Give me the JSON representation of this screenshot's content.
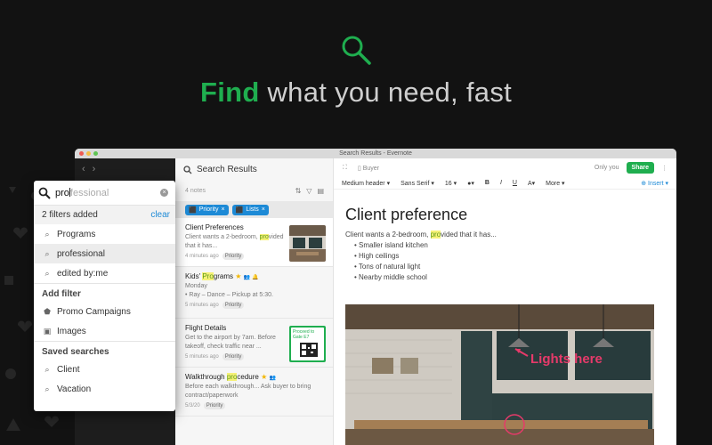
{
  "hero": {
    "headline_accent": "Find",
    "headline_rest": " what you need, fast",
    "accent_color": "#1fae4f",
    "icon": "search-icon"
  },
  "window": {
    "title": "Search Results - Evernote"
  },
  "notelist": {
    "header": "Search Results",
    "count": "4 notes",
    "chips": [
      "Priority",
      "Lists"
    ],
    "notes": [
      {
        "title": "Client Preferences",
        "body_pre": "Client wants a 2-bedroom, ",
        "body_hl": "pro",
        "body_post": "vided that it has...",
        "time": "4 minutes ago",
        "tag": "Priority"
      },
      {
        "title_pre": "Kids' ",
        "title_hl": "Pro",
        "title_post": "grams",
        "body_line1": "Monday",
        "body_line2": "• Ray – Dance – Pickup at 5:30.",
        "time": "5 minutes ago",
        "tag": "Priority"
      },
      {
        "title": "Flight Details",
        "body": "Get to the airport by 7am. Before takeoff, check traffic near ...",
        "time": "5 minutes ago",
        "tag": "Priority",
        "ticket_line1": "Proceed to",
        "ticket_line2": "Gate E7"
      },
      {
        "title_pre": "Walkthrough ",
        "title_hl": "pro",
        "title_post": "cedure",
        "body": "Before each walkthrough... Ask buyer to bring contract/paperwork",
        "time": "5/3/20",
        "tag": "Priority"
      }
    ]
  },
  "editor": {
    "notebook": "Buyer",
    "visibility": "Only you",
    "share": "Share",
    "format": {
      "style": "Medium header",
      "font": "Sans Serif",
      "size": "16",
      "bold": "B",
      "italic": "I",
      "underline": "U",
      "highlight": "A",
      "more": "More",
      "insert": "Insert"
    },
    "doc_title": "Client preference",
    "doc_intro_pre": "Client wants a 2-bedroom, ",
    "doc_intro_hl": "pro",
    "doc_intro_post": "vided that it has...",
    "bullets": [
      "Smaller island kitchen",
      "High ceilings",
      "Tons of natural light",
      "Nearby middle school"
    ],
    "image_annotation": "Lights here"
  },
  "search": {
    "typed": "pro",
    "suggestion_rest": "fessional",
    "filters_text": "2 filters added",
    "clear_label": "clear",
    "suggestions": [
      "Programs",
      "professional",
      "edited by:me"
    ],
    "add_filter_title": "Add filter",
    "add_filters": [
      {
        "label": "Promo Campaigns",
        "icon": "tag-icon"
      },
      {
        "label": "Images",
        "icon": "image-icon"
      }
    ],
    "saved_title": "Saved searches",
    "saved": [
      "Client",
      "Vacation"
    ]
  }
}
